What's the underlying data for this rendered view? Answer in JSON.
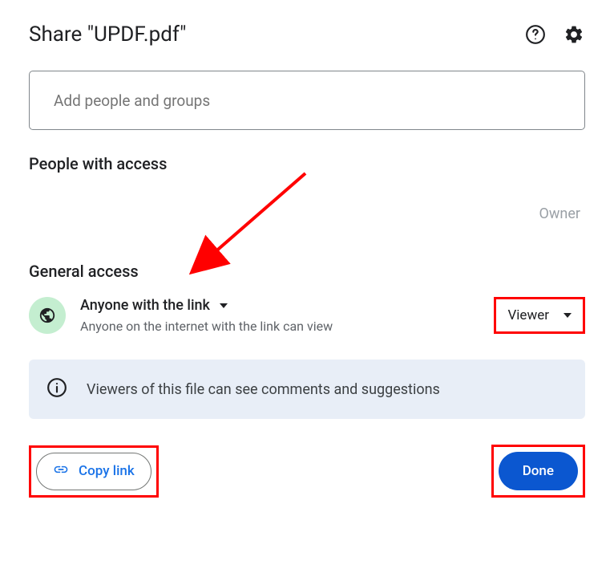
{
  "header": {
    "title": "Share \"UPDF.pdf\""
  },
  "input": {
    "placeholder": "Add people and groups"
  },
  "sections": {
    "people_access": "People with access",
    "general_access": "General access"
  },
  "owner": {
    "role": "Owner"
  },
  "access": {
    "scope_label": "Anyone with the link",
    "scope_desc": "Anyone on the internet with the link can view",
    "role": "Viewer"
  },
  "info_banner": {
    "text": "Viewers of this file can see comments and suggestions"
  },
  "footer": {
    "copy_link": "Copy link",
    "done": "Done"
  }
}
